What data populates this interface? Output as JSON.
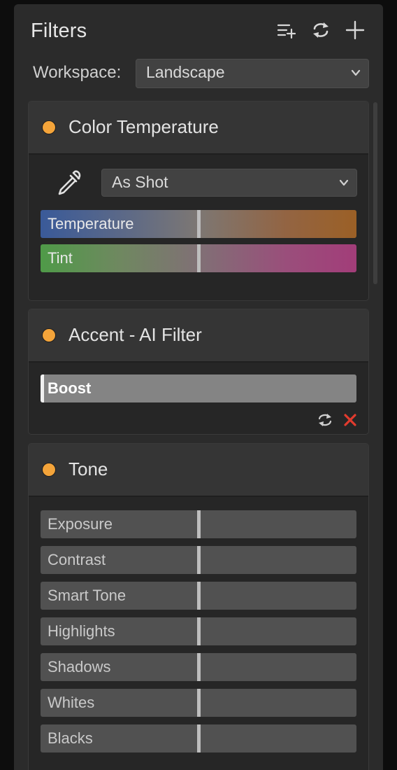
{
  "panel": {
    "title": "Filters",
    "header_icons": [
      "add-list-icon",
      "sync-icon",
      "plus-icon"
    ]
  },
  "workspace": {
    "label": "Workspace:",
    "selected": "Landscape"
  },
  "colors": {
    "panel_bg": "#2b2b2b",
    "card_header_bg": "#353535",
    "status_dot": "#f4a43a",
    "delete_red": "#e23b2e"
  },
  "cards": {
    "color_temperature": {
      "title": "Color Temperature",
      "white_balance_preset": "As Shot",
      "sliders": [
        {
          "label": "Temperature",
          "value_fraction": 0.5
        },
        {
          "label": "Tint",
          "value_fraction": 0.5
        }
      ]
    },
    "accent_ai": {
      "title": "Accent - AI Filter",
      "slider": {
        "label": "Boost",
        "value_fraction": 0.0
      },
      "footer_icons": [
        "reset-icon",
        "delete-icon"
      ]
    },
    "tone": {
      "title": "Tone",
      "sliders": [
        {
          "label": "Exposure",
          "value_fraction": 0.5
        },
        {
          "label": "Contrast",
          "value_fraction": 0.5
        },
        {
          "label": "Smart Tone",
          "value_fraction": 0.5
        },
        {
          "label": "Highlights",
          "value_fraction": 0.5
        },
        {
          "label": "Shadows",
          "value_fraction": 0.5
        },
        {
          "label": "Whites",
          "value_fraction": 0.5
        },
        {
          "label": "Blacks",
          "value_fraction": 0.5
        }
      ]
    }
  }
}
